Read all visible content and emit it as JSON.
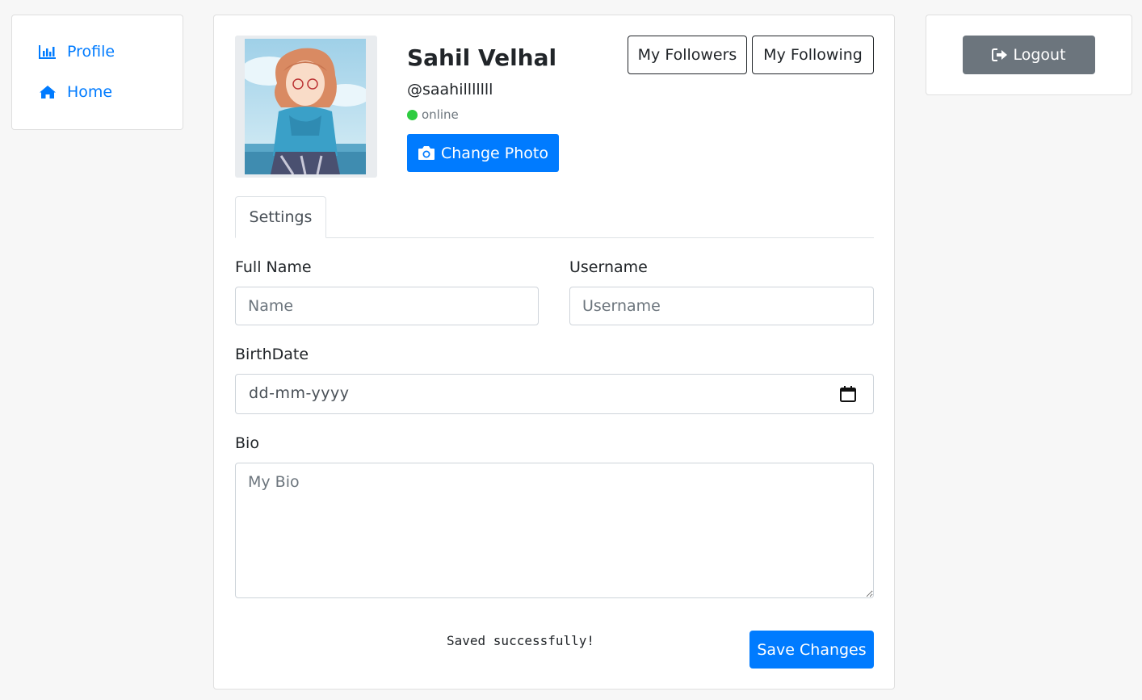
{
  "nav": {
    "items": [
      {
        "label": "Profile",
        "icon": "bar-chart-icon"
      },
      {
        "label": "Home",
        "icon": "home-icon"
      }
    ],
    "link_color": "#007bff"
  },
  "logout": {
    "label": "Logout",
    "icon": "sign-out-icon",
    "color": "#6c757d"
  },
  "profile": {
    "name": "Sahil Velhal",
    "handle": "@saahilllllll",
    "status": "online",
    "status_color": "#2ecc40",
    "change_photo_label": "Change Photo",
    "change_photo_icon": "camera-icon",
    "followers_label": "My Followers",
    "following_label": "My Following"
  },
  "tabs": [
    {
      "label": "Settings",
      "active": true
    }
  ],
  "form": {
    "full_name": {
      "label": "Full Name",
      "placeholder": "Name",
      "value": ""
    },
    "username": {
      "label": "Username",
      "placeholder": "Username",
      "value": ""
    },
    "birthdate": {
      "label": "BirthDate",
      "placeholder": "dd-mm-yyyy",
      "icon": "calendar-icon"
    },
    "bio": {
      "label": "Bio",
      "placeholder": "My Bio",
      "value": ""
    },
    "save_message": "Saved successfully!",
    "save_label": "Save Changes",
    "primary_color": "#007bff"
  }
}
